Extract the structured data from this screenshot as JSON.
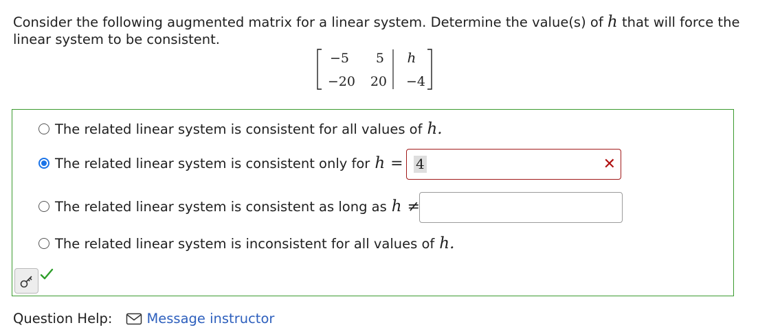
{
  "question": {
    "text_part1": "Consider the following augmented matrix for a linear system. Determine the value(s) of",
    "variable": "h",
    "text_part2": "that will force the linear system to be consistent.",
    "matrix": {
      "rows": [
        [
          "−5",
          "5",
          "h"
        ],
        [
          "−20",
          "20",
          "−4"
        ]
      ]
    }
  },
  "options": [
    {
      "text": "The related linear system is consistent for all values of",
      "math": "h.",
      "selected": false
    },
    {
      "text": "The related linear system is consistent only for",
      "math": "h",
      "operator": "=",
      "selected": true
    },
    {
      "text": "The related linear system is consistent as long as",
      "math": "h",
      "operator": "≠",
      "selected": false
    },
    {
      "text": "The related linear system is inconsistent for all values of",
      "math": "h.",
      "selected": false
    }
  ],
  "inputs": {
    "consistent_only_for_value": "4",
    "consistent_as_long_as_value": ""
  },
  "status": {
    "input_result_icon": "x-mark-icon",
    "input_result_color": "#b01010",
    "answer_result_icon": "checkmark-icon",
    "answer_result_color": "#2e9e2a"
  },
  "help": {
    "label": "Question Help:",
    "link_text": "Message instructor",
    "link_icon": "mail-icon"
  },
  "colors": {
    "box_border": "#3a9a2e",
    "link": "#2d5fbd",
    "radio_selected": "#1a73e8",
    "error_border": "#a01818"
  }
}
